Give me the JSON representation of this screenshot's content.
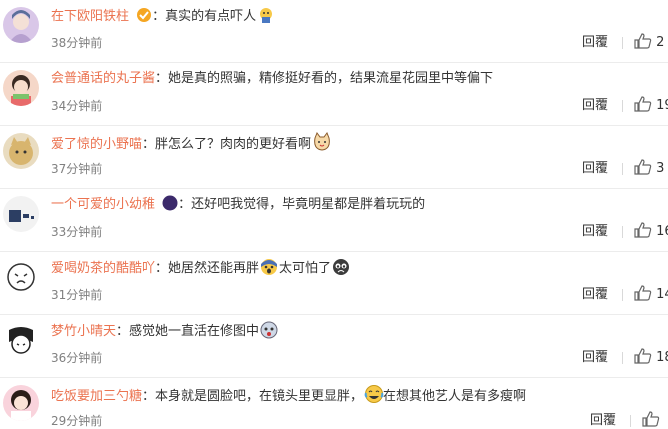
{
  "comments": [
    {
      "user": "在下欧阳铁柱",
      "separator": "：",
      "text": "真实的有点吓人",
      "text2": "",
      "time": "38分钟前",
      "reply": "回覆",
      "likes": "2"
    },
    {
      "user": "会普通话的丸子酱",
      "separator": "：",
      "text": "她是真的照骗，精修挺好看的，结果流星花园里中等偏下",
      "text2": "",
      "time": "34分钟前",
      "reply": "回覆",
      "likes": "19"
    },
    {
      "user": "爱了惊的小野喵",
      "separator": "：",
      "text": "胖怎么了？肉肉的更好看啊",
      "text2": "",
      "time": "37分钟前",
      "reply": "回覆",
      "likes": "3"
    },
    {
      "user": "一个可爱的小幼稚",
      "separator": "：",
      "text": "还好吧我觉得，毕竟明星都是胖着玩玩的",
      "text2": "",
      "time": "33分钟前",
      "reply": "回覆",
      "likes": "16"
    },
    {
      "user": "爱喝奶茶的酷酷吖",
      "separator": "：",
      "text": "她居然还能再胖",
      "text2": "太可怕了",
      "time": "31分钟前",
      "reply": "回覆",
      "likes": "14"
    },
    {
      "user": "梦竹小晴天",
      "separator": "：",
      "text": "感觉她一直活在修图中",
      "text2": "",
      "time": "36分钟前",
      "reply": "回覆",
      "likes": "18"
    },
    {
      "user": "吃饭要加三勺糖",
      "separator": "：",
      "text": "本身就是圆脸吧，在镜头里更显胖，",
      "text2": "在想其他艺人是有多瘦啊",
      "time": "29分钟前",
      "reply": "回覆",
      "likes": ""
    }
  ],
  "icons": {
    "like": "thumbs-up-icon",
    "emoji_scared": "scared-emoji-icon",
    "emoji_cat": "cat-emoji-icon",
    "emoji_shock": "shocked-emoji-icon",
    "emoji_cry": "crying-emoji-icon",
    "emoji_laughcry": "laugh-cry-emoji-icon"
  },
  "colors": {
    "username": "#eb7350",
    "time": "#808080",
    "text": "#333333",
    "divider": "#ececec"
  }
}
